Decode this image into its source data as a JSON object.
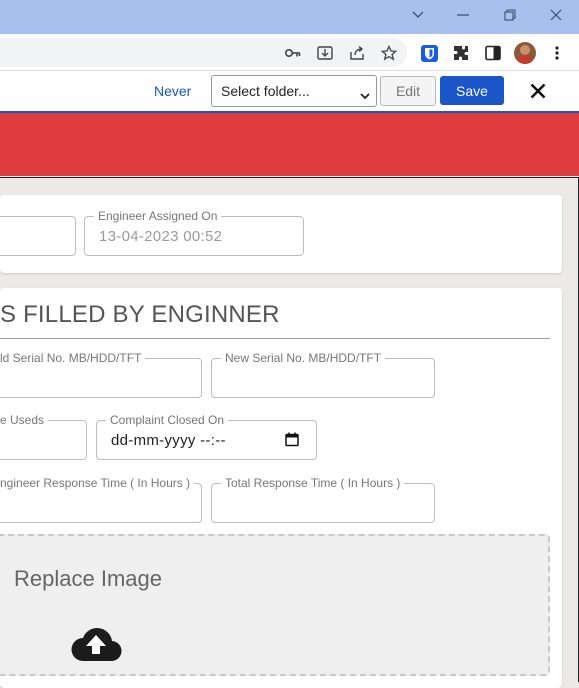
{
  "browser": {
    "window_controls": [
      "chevron-down",
      "minimize",
      "restore",
      "close"
    ],
    "toolbar_icons": [
      "key-icon",
      "install-icon",
      "share-icon",
      "star-icon",
      "bitwarden-icon",
      "extensions-icon",
      "sidepanel-icon",
      "profile-avatar",
      "menu-icon"
    ]
  },
  "password_bar": {
    "never_label": "Never",
    "folder_value": "Select folder...",
    "edit_label": "Edit",
    "save_label": "Save",
    "accent": "#1a56c7"
  },
  "banner": {
    "color": "#e03b3d"
  },
  "form": {
    "engineer_assigned_label": "Engineer Assigned On",
    "engineer_assigned_value": "13-04-2023 00:52",
    "section_title": "S FILLED BY ENGINNER",
    "old_serial_label": "ld Serial No. MB/HDD/TFT",
    "new_serial_label": "New Serial No. MB/HDD/TFT",
    "parts_used_label": "e Useds",
    "complaint_closed_label": "Complaint Closed On",
    "complaint_closed_value": "dd-mm-yyyy --:--",
    "engineer_response_label": "ngineer Response Time ( In Hours )",
    "total_response_label": "Total Response Time ( In Hours )",
    "replace_image_label": "Replace Image"
  }
}
